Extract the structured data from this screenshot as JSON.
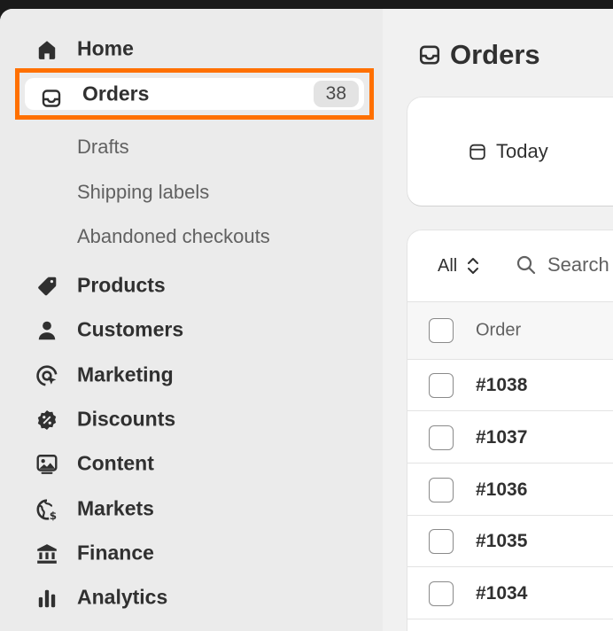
{
  "sidebar": {
    "items": [
      {
        "label": "Home",
        "icon": "home-icon"
      },
      {
        "label": "Orders",
        "icon": "inbox-icon",
        "count": "38",
        "active": true
      },
      {
        "label": "Products",
        "icon": "tag-icon"
      },
      {
        "label": "Customers",
        "icon": "person-icon"
      },
      {
        "label": "Marketing",
        "icon": "target-icon"
      },
      {
        "label": "Discounts",
        "icon": "discount-icon"
      },
      {
        "label": "Content",
        "icon": "image-icon"
      },
      {
        "label": "Markets",
        "icon": "globe-icon"
      },
      {
        "label": "Finance",
        "icon": "bank-icon"
      },
      {
        "label": "Analytics",
        "icon": "bar-chart-icon"
      }
    ],
    "orders_subitems": [
      "Drafts",
      "Shipping labels",
      "Abandoned checkouts"
    ]
  },
  "colors": {
    "highlight": "#ff7000",
    "sidebar_bg": "#ebebeb",
    "main_bg": "#f1f1f1"
  },
  "main": {
    "title": "Orders",
    "date_button": "Today",
    "filter": {
      "view": "All",
      "search_placeholder": "Search"
    },
    "table": {
      "columns": [
        "Order"
      ],
      "rows": [
        {
          "order": "#1038"
        },
        {
          "order": "#1037"
        },
        {
          "order": "#1036"
        },
        {
          "order": "#1035"
        },
        {
          "order": "#1034"
        }
      ]
    }
  }
}
